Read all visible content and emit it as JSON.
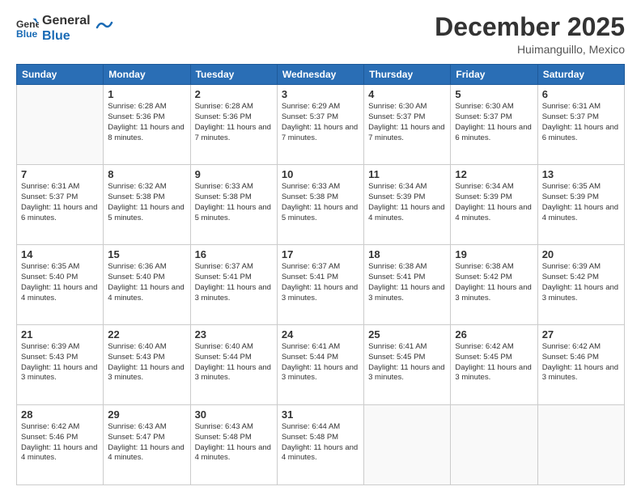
{
  "header": {
    "logo_line1": "General",
    "logo_line2": "Blue",
    "month": "December 2025",
    "location": "Huimanguillo, Mexico"
  },
  "days_of_week": [
    "Sunday",
    "Monday",
    "Tuesday",
    "Wednesday",
    "Thursday",
    "Friday",
    "Saturday"
  ],
  "weeks": [
    [
      {
        "day": "",
        "sunrise": "",
        "sunset": "",
        "daylight": ""
      },
      {
        "day": "1",
        "sunrise": "Sunrise: 6:28 AM",
        "sunset": "Sunset: 5:36 PM",
        "daylight": "Daylight: 11 hours and 8 minutes."
      },
      {
        "day": "2",
        "sunrise": "Sunrise: 6:28 AM",
        "sunset": "Sunset: 5:36 PM",
        "daylight": "Daylight: 11 hours and 7 minutes."
      },
      {
        "day": "3",
        "sunrise": "Sunrise: 6:29 AM",
        "sunset": "Sunset: 5:37 PM",
        "daylight": "Daylight: 11 hours and 7 minutes."
      },
      {
        "day": "4",
        "sunrise": "Sunrise: 6:30 AM",
        "sunset": "Sunset: 5:37 PM",
        "daylight": "Daylight: 11 hours and 7 minutes."
      },
      {
        "day": "5",
        "sunrise": "Sunrise: 6:30 AM",
        "sunset": "Sunset: 5:37 PM",
        "daylight": "Daylight: 11 hours and 6 minutes."
      },
      {
        "day": "6",
        "sunrise": "Sunrise: 6:31 AM",
        "sunset": "Sunset: 5:37 PM",
        "daylight": "Daylight: 11 hours and 6 minutes."
      }
    ],
    [
      {
        "day": "7",
        "sunrise": "Sunrise: 6:31 AM",
        "sunset": "Sunset: 5:37 PM",
        "daylight": "Daylight: 11 hours and 6 minutes."
      },
      {
        "day": "8",
        "sunrise": "Sunrise: 6:32 AM",
        "sunset": "Sunset: 5:38 PM",
        "daylight": "Daylight: 11 hours and 5 minutes."
      },
      {
        "day": "9",
        "sunrise": "Sunrise: 6:33 AM",
        "sunset": "Sunset: 5:38 PM",
        "daylight": "Daylight: 11 hours and 5 minutes."
      },
      {
        "day": "10",
        "sunrise": "Sunrise: 6:33 AM",
        "sunset": "Sunset: 5:38 PM",
        "daylight": "Daylight: 11 hours and 5 minutes."
      },
      {
        "day": "11",
        "sunrise": "Sunrise: 6:34 AM",
        "sunset": "Sunset: 5:39 PM",
        "daylight": "Daylight: 11 hours and 4 minutes."
      },
      {
        "day": "12",
        "sunrise": "Sunrise: 6:34 AM",
        "sunset": "Sunset: 5:39 PM",
        "daylight": "Daylight: 11 hours and 4 minutes."
      },
      {
        "day": "13",
        "sunrise": "Sunrise: 6:35 AM",
        "sunset": "Sunset: 5:39 PM",
        "daylight": "Daylight: 11 hours and 4 minutes."
      }
    ],
    [
      {
        "day": "14",
        "sunrise": "Sunrise: 6:35 AM",
        "sunset": "Sunset: 5:40 PM",
        "daylight": "Daylight: 11 hours and 4 minutes."
      },
      {
        "day": "15",
        "sunrise": "Sunrise: 6:36 AM",
        "sunset": "Sunset: 5:40 PM",
        "daylight": "Daylight: 11 hours and 4 minutes."
      },
      {
        "day": "16",
        "sunrise": "Sunrise: 6:37 AM",
        "sunset": "Sunset: 5:41 PM",
        "daylight": "Daylight: 11 hours and 3 minutes."
      },
      {
        "day": "17",
        "sunrise": "Sunrise: 6:37 AM",
        "sunset": "Sunset: 5:41 PM",
        "daylight": "Daylight: 11 hours and 3 minutes."
      },
      {
        "day": "18",
        "sunrise": "Sunrise: 6:38 AM",
        "sunset": "Sunset: 5:41 PM",
        "daylight": "Daylight: 11 hours and 3 minutes."
      },
      {
        "day": "19",
        "sunrise": "Sunrise: 6:38 AM",
        "sunset": "Sunset: 5:42 PM",
        "daylight": "Daylight: 11 hours and 3 minutes."
      },
      {
        "day": "20",
        "sunrise": "Sunrise: 6:39 AM",
        "sunset": "Sunset: 5:42 PM",
        "daylight": "Daylight: 11 hours and 3 minutes."
      }
    ],
    [
      {
        "day": "21",
        "sunrise": "Sunrise: 6:39 AM",
        "sunset": "Sunset: 5:43 PM",
        "daylight": "Daylight: 11 hours and 3 minutes."
      },
      {
        "day": "22",
        "sunrise": "Sunrise: 6:40 AM",
        "sunset": "Sunset: 5:43 PM",
        "daylight": "Daylight: 11 hours and 3 minutes."
      },
      {
        "day": "23",
        "sunrise": "Sunrise: 6:40 AM",
        "sunset": "Sunset: 5:44 PM",
        "daylight": "Daylight: 11 hours and 3 minutes."
      },
      {
        "day": "24",
        "sunrise": "Sunrise: 6:41 AM",
        "sunset": "Sunset: 5:44 PM",
        "daylight": "Daylight: 11 hours and 3 minutes."
      },
      {
        "day": "25",
        "sunrise": "Sunrise: 6:41 AM",
        "sunset": "Sunset: 5:45 PM",
        "daylight": "Daylight: 11 hours and 3 minutes."
      },
      {
        "day": "26",
        "sunrise": "Sunrise: 6:42 AM",
        "sunset": "Sunset: 5:45 PM",
        "daylight": "Daylight: 11 hours and 3 minutes."
      },
      {
        "day": "27",
        "sunrise": "Sunrise: 6:42 AM",
        "sunset": "Sunset: 5:46 PM",
        "daylight": "Daylight: 11 hours and 3 minutes."
      }
    ],
    [
      {
        "day": "28",
        "sunrise": "Sunrise: 6:42 AM",
        "sunset": "Sunset: 5:46 PM",
        "daylight": "Daylight: 11 hours and 4 minutes."
      },
      {
        "day": "29",
        "sunrise": "Sunrise: 6:43 AM",
        "sunset": "Sunset: 5:47 PM",
        "daylight": "Daylight: 11 hours and 4 minutes."
      },
      {
        "day": "30",
        "sunrise": "Sunrise: 6:43 AM",
        "sunset": "Sunset: 5:48 PM",
        "daylight": "Daylight: 11 hours and 4 minutes."
      },
      {
        "day": "31",
        "sunrise": "Sunrise: 6:44 AM",
        "sunset": "Sunset: 5:48 PM",
        "daylight": "Daylight: 11 hours and 4 minutes."
      },
      {
        "day": "",
        "sunrise": "",
        "sunset": "",
        "daylight": ""
      },
      {
        "day": "",
        "sunrise": "",
        "sunset": "",
        "daylight": ""
      },
      {
        "day": "",
        "sunrise": "",
        "sunset": "",
        "daylight": ""
      }
    ]
  ]
}
